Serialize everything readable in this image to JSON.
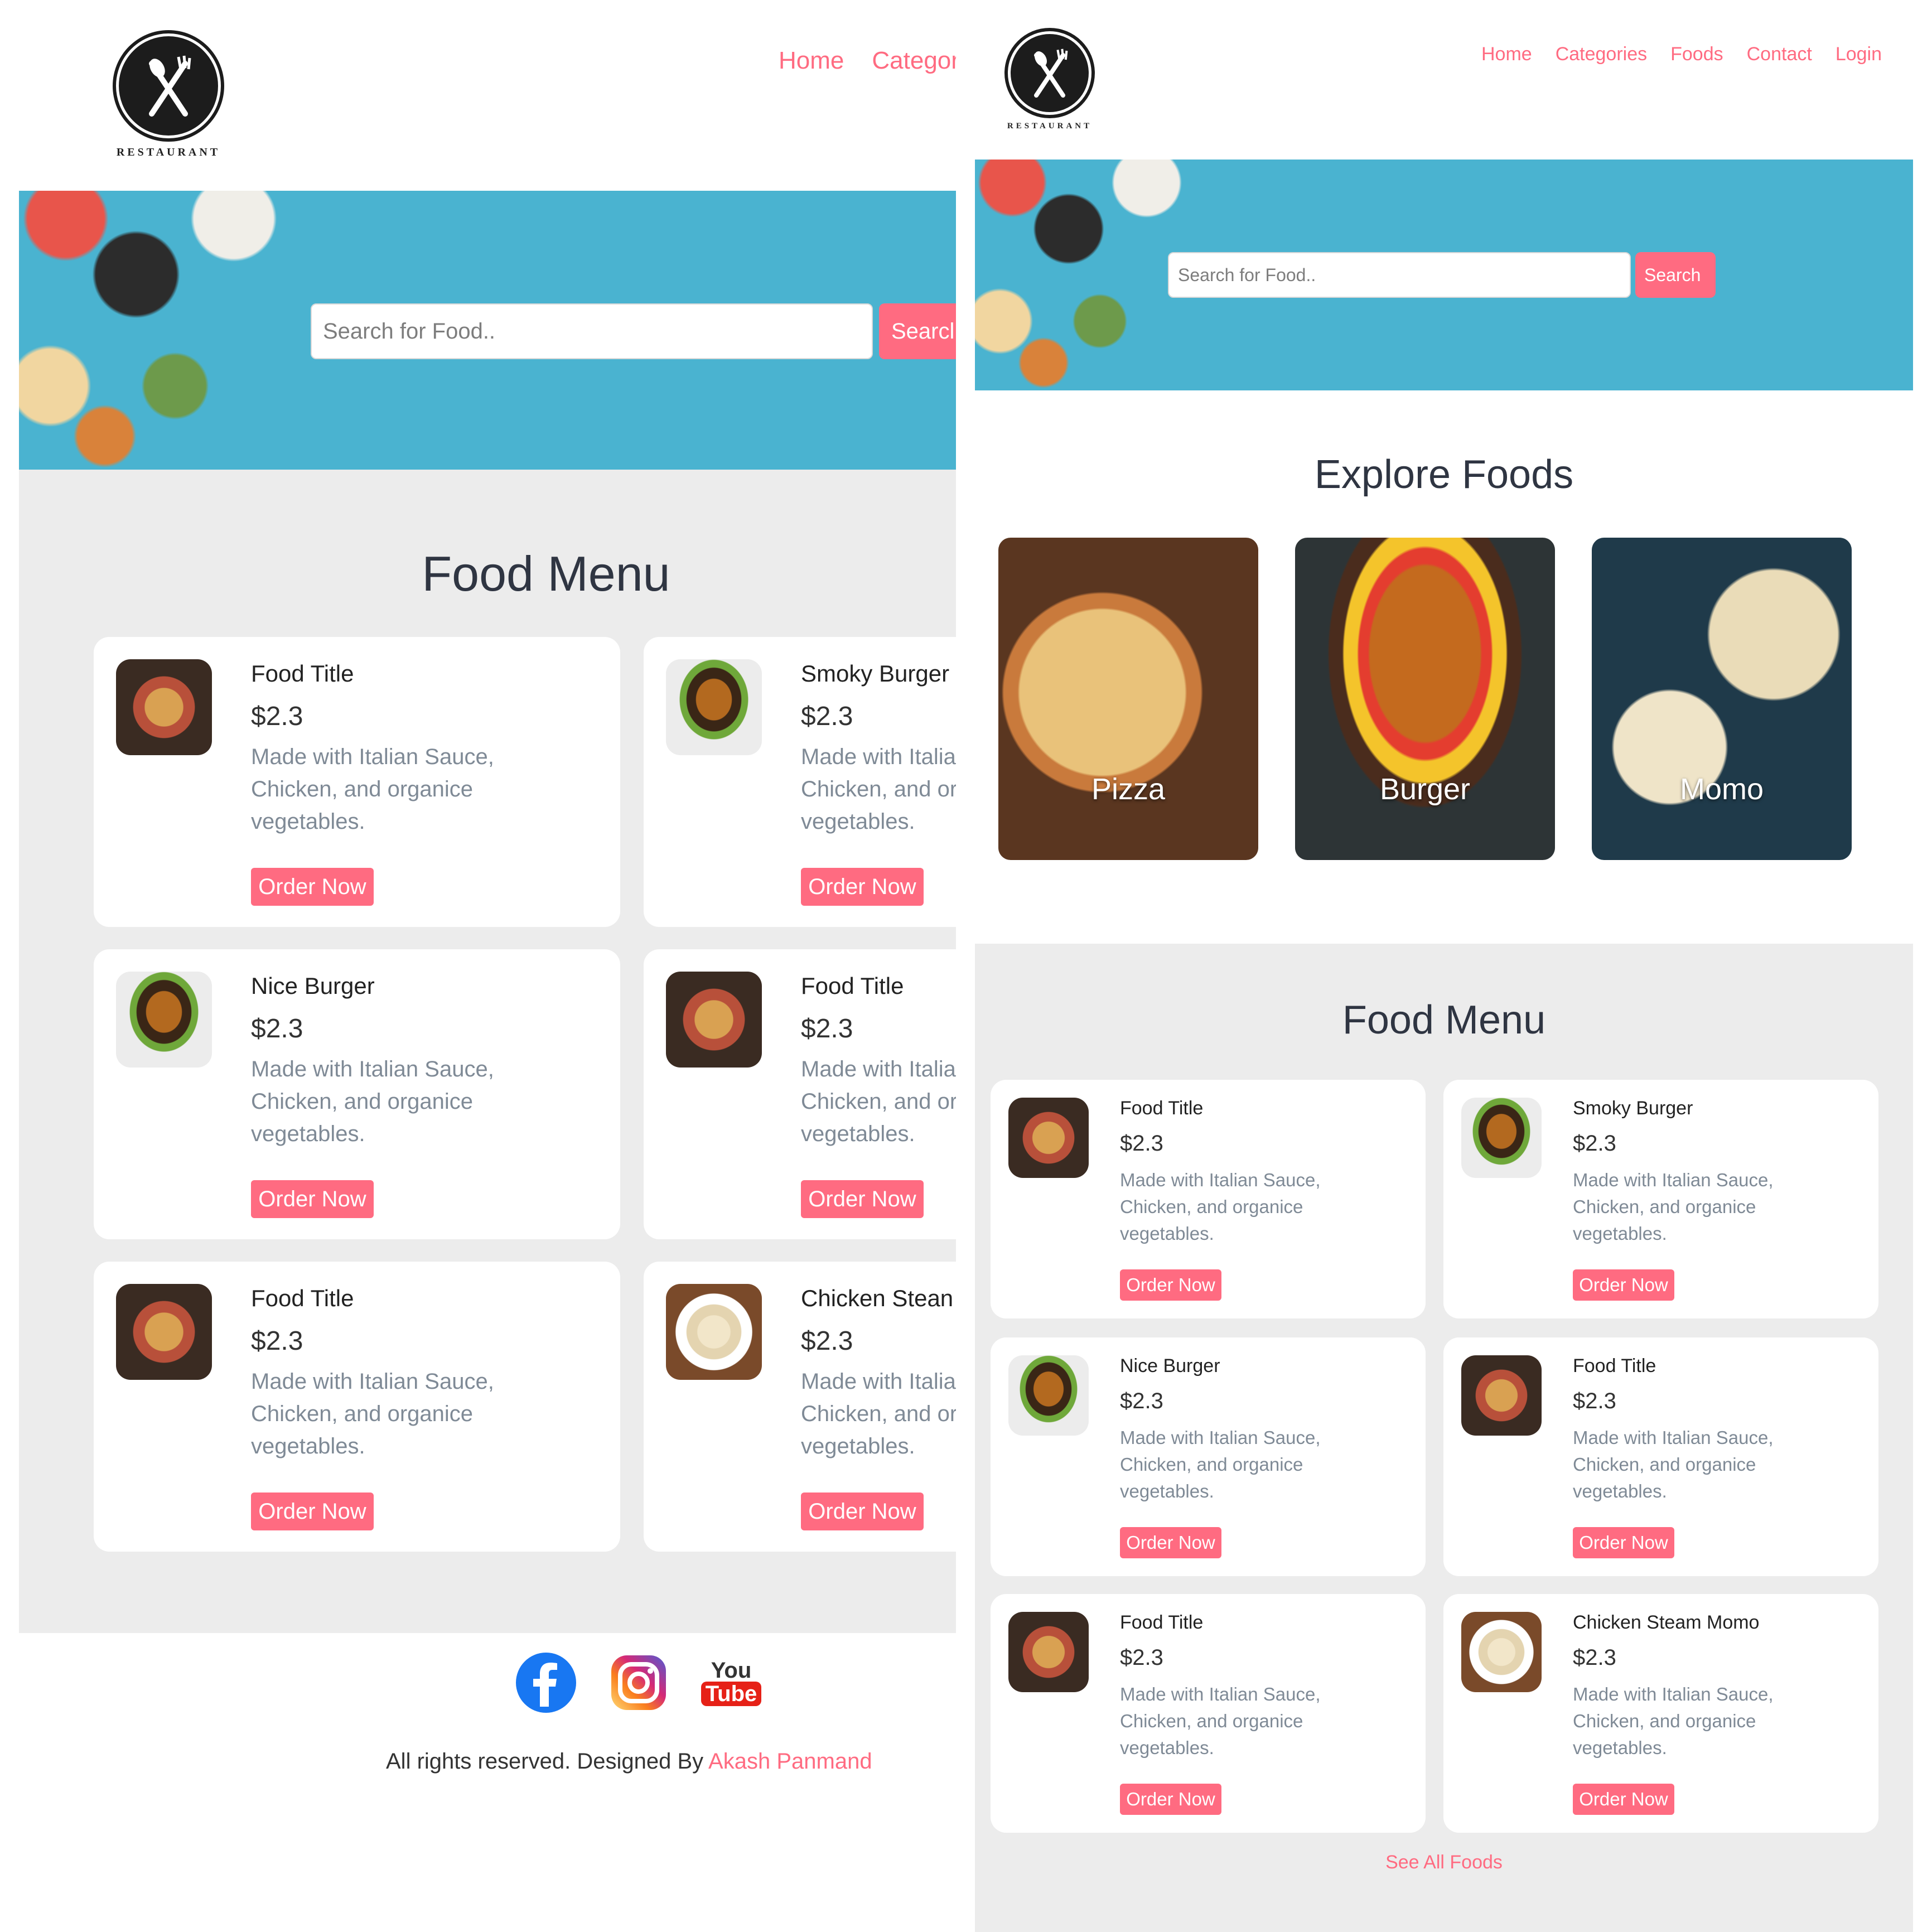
{
  "logo": {
    "text": "RESTAURANT",
    "icon": "fork-knife-icon"
  },
  "nav_left": [
    "Home",
    "Categor"
  ],
  "nav_right": [
    "Home",
    "Categories",
    "Foods",
    "Contact",
    "Login"
  ],
  "search": {
    "placeholder": "Search for Food..",
    "button_left": "Searcl",
    "button_right": "Search"
  },
  "explore": {
    "title": "Explore Foods",
    "categories": [
      "Pizza",
      "Burger",
      "Momo"
    ]
  },
  "menu": {
    "title": "Food Menu",
    "items": [
      {
        "title": "Food Title",
        "price": "$2.3",
        "description": "Made with Italian Sauce, Chicken, and organice vegetables.",
        "image": "pizza"
      },
      {
        "title": "Smoky Burger",
        "price": "$2.3",
        "description": "Made with Italian Sauce, Chicken, and organice vegetables.",
        "image": "burger"
      },
      {
        "title": "Nice Burger",
        "price": "$2.3",
        "description": "Made with Italian Sauce, Chicken, and organice vegetables.",
        "image": "burger"
      },
      {
        "title": "Food Title",
        "price": "$2.3",
        "description": "Made with Italian Sauce, Chicken, and organice vegetables.",
        "image": "pizza"
      },
      {
        "title": "Food Title",
        "price": "$2.3",
        "description": "Made with Italian Sauce, Chicken, and organice vegetables.",
        "image": "pizza"
      },
      {
        "title": "Chicken Steam Momo",
        "price": "$2.3",
        "description": "Made with Italian Sauce, Chicken, and organice vegetables.",
        "image": "momo"
      }
    ],
    "left_truncated": {
      "title_1": "Smoky Burger",
      "title_3": "Food Title",
      "title_5": "Chicken Stean",
      "desc_partial": "Made with Itali… Chicken, and o… vegetables."
    },
    "order_label": "Order Now",
    "see_all": "See All Foods"
  },
  "footer": {
    "social": [
      "facebook-icon",
      "instagram-icon",
      "youtube-icon"
    ],
    "youtube_text": [
      "You",
      "Tube"
    ],
    "copyright": "All rights reserved. Designed By ",
    "author": "Akash Panmand"
  },
  "colors": {
    "accent": "#ff6b81",
    "hero": "#4ab3d0",
    "section_bg": "#ececec",
    "heading": "#2f3542"
  }
}
